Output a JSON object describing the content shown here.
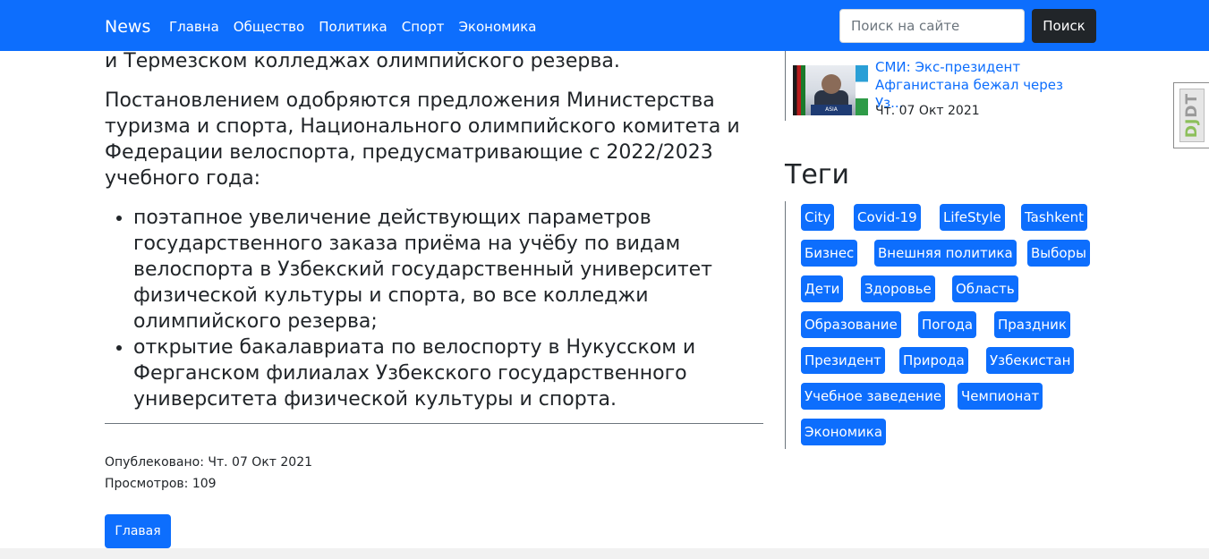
{
  "navbar": {
    "brand": "News",
    "links": [
      "Главна",
      "Общество",
      "Политика",
      "Спорт",
      "Экономика"
    ],
    "search_placeholder": "Поиск на сайте",
    "search_button": "Поиск"
  },
  "article": {
    "prev_text": "и Термезском колледжах олимпийского резерва.",
    "decree_text": "Постановлением одобряются предложения Министерства туризма и спорта, Национального олимпийского комитета и Федерации велоспорта, предусматривающие с 2022/2023 учебного года:",
    "bullets": [
      "поэтапное увеличение действующих параметров государственного заказа приёма на учёбу по видам велоспорта в Узбекский государственный университет физической культуры и спорта, во все колледжи олимпийского резерва;",
      "открытие бакалавриата по велоспорту в Нукусском и Ферганском филиалах Узбекского государственного университета физической культуры и спорта."
    ],
    "published": "Опублековано: Чт. 07 Окт 2021",
    "views": "Просмотров: 109",
    "home_button": "Главая"
  },
  "sidebar": {
    "news": {
      "title": "СМИ: Экс-президент Афганистана бежал через Уз...",
      "date": "Чт. 07 Окт 2021",
      "thumb_caption": "ASIA"
    },
    "tags_heading": "Теги",
    "tags": [
      "City",
      "Covid-19",
      "LifeStyle",
      "Tashkent",
      "Бизнес",
      "Внешняя политика",
      "Выборы",
      "Дети",
      "Здоровье",
      "Область",
      "Образование",
      "Погода",
      "Праздник",
      "Президент",
      "Природа",
      "Узбекистан",
      "Учебное заведение",
      "Чемпионат",
      "Экономика"
    ]
  },
  "toolbar": {
    "dj": "DJ",
    "dt": "DT"
  },
  "colors": {
    "primary": "#0d6efd",
    "dark": "#212529",
    "text": "#212529"
  }
}
